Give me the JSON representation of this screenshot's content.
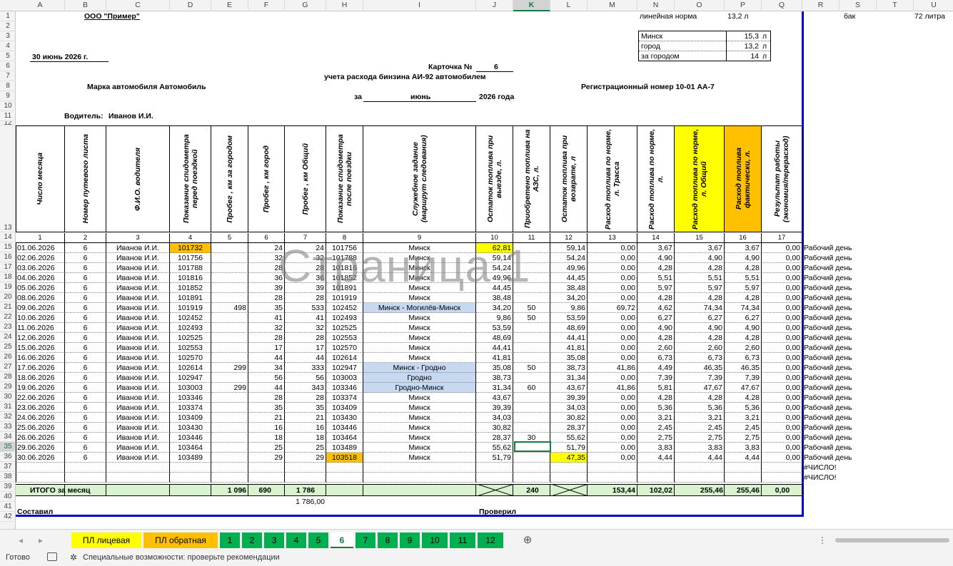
{
  "column_headers": [
    "A",
    "B",
    "C",
    "D",
    "E",
    "F",
    "G",
    "H",
    "I",
    "J",
    "K",
    "L",
    "M",
    "N",
    "O",
    "P",
    "Q",
    "R",
    "S",
    "T",
    "U"
  ],
  "selected_column": "K",
  "selected_row": "35",
  "top": {
    "company": "ООО \"Пример\"",
    "date": "30 июнь 2026 г.",
    "card_label": "Карточка №",
    "card_number": "6",
    "subtitle": "учета расхода бинзина АИ-92 автомобилем",
    "brand": "Марка автомобиля Автомобиль",
    "reg_number": "Регистрационный номер 10-01 АА-7",
    "period_for": "за",
    "period_month": "июнь",
    "period_year": "2026 года",
    "driver_label": "Водитель:",
    "driver_name": "Иванов И.И."
  },
  "norms": {
    "linear_label": "линейная норма",
    "linear_value": "13,2 л",
    "tank_label": "бак",
    "tank_value": "72 литра",
    "minsk_label": "Минск",
    "minsk_value": "15,3",
    "city_label": "город",
    "city_value": "13,2",
    "outside_label": "за городом",
    "outside_value": "14",
    "unit": "л"
  },
  "table_headers": [
    "Число месяца",
    "Номер путевого листа",
    "Ф.И.О. водителя",
    "Показание спидометра перед поездкой",
    "Пробег , км  за городом",
    "Пробег , км город",
    "Пробег , км Общий",
    "Показание спидометра после поездки",
    "Служебное задание (маршрут следования)",
    "Остаток топлива при выезде, л.",
    "Приобретено топлива на АЗС, л.",
    "Остаток топлива при возврате, л",
    "Расход топлива по норме, л. Трасса",
    "Расход топлива по норме, л.",
    "Расход топлива по норме, л. Общий",
    "Расход топлива фактически, л.",
    "Результат работы (экономия/перерасход)"
  ],
  "column_numbers": [
    "1",
    "2",
    "3",
    "4",
    "5",
    "6",
    "7",
    "8",
    "9",
    "10",
    "11",
    "12",
    "13",
    "14",
    "15",
    "16",
    "17"
  ],
  "rows": [
    [
      "01.06.2026",
      "6",
      "Иванов И.И.",
      "101732",
      "",
      "24",
      "24",
      "101756",
      "Минск",
      "62,81",
      "",
      "59,14",
      "0,00",
      "3,67",
      "3,67",
      "3,67",
      "0,00",
      "Рабочий день"
    ],
    [
      "02.06.2026",
      "6",
      "Иванов И.И.",
      "101756",
      "",
      "32",
      "32",
      "101788",
      "Минск",
      "59,14",
      "",
      "54,24",
      "0,00",
      "4,90",
      "4,90",
      "4,90",
      "0,00",
      "Рабочий день"
    ],
    [
      "03.06.2026",
      "6",
      "Иванов И.И.",
      "101788",
      "",
      "28",
      "28",
      "101816",
      "Минск",
      "54,24",
      "",
      "49,96",
      "0,00",
      "4,28",
      "4,28",
      "4,28",
      "0,00",
      "Рабочий день"
    ],
    [
      "04.06.2026",
      "6",
      "Иванов И.И.",
      "101816",
      "",
      "36",
      "36",
      "101852",
      "Минск",
      "49,96",
      "",
      "44,45",
      "0,00",
      "5,51",
      "5,51",
      "5,51",
      "0,00",
      "Рабочий день"
    ],
    [
      "05.06.2026",
      "6",
      "Иванов И.И.",
      "101852",
      "",
      "39",
      "39",
      "101891",
      "Минск",
      "44,45",
      "",
      "38,48",
      "0,00",
      "5,97",
      "5,97",
      "5,97",
      "0,00",
      "Рабочий день"
    ],
    [
      "08.06.2026",
      "6",
      "Иванов И.И.",
      "101891",
      "",
      "28",
      "28",
      "101919",
      "Минск",
      "38,48",
      "",
      "34,20",
      "0,00",
      "4,28",
      "4,28",
      "4,28",
      "0,00",
      "Рабочий день"
    ],
    [
      "09.06.2026",
      "6",
      "Иванов И.И.",
      "101919",
      "498",
      "35",
      "533",
      "102452",
      "Минск - Могилёв-Минск",
      "34,20",
      "50",
      "9,86",
      "69,72",
      "4,62",
      "74,34",
      "74,34",
      "0,00",
      "Рабочий день"
    ],
    [
      "10.06.2026",
      "6",
      "Иванов И.И.",
      "102452",
      "",
      "41",
      "41",
      "102493",
      "Минск",
      "9,86",
      "50",
      "53,59",
      "0,00",
      "6,27",
      "6,27",
      "6,27",
      "0,00",
      "Рабочий день"
    ],
    [
      "11.06.2026",
      "6",
      "Иванов И.И.",
      "102493",
      "",
      "32",
      "32",
      "102525",
      "Минск",
      "53,59",
      "",
      "48,69",
      "0,00",
      "4,90",
      "4,90",
      "4,90",
      "0,00",
      "Рабочий день"
    ],
    [
      "12.06.2026",
      "6",
      "Иванов И.И.",
      "102525",
      "",
      "28",
      "28",
      "102553",
      "Минск",
      "48,69",
      "",
      "44,41",
      "0,00",
      "4,28",
      "4,28",
      "4,28",
      "0,00",
      "Рабочий день"
    ],
    [
      "15.06.2026",
      "6",
      "Иванов И.И.",
      "102553",
      "",
      "17",
      "17",
      "102570",
      "Минск",
      "44,41",
      "",
      "41,81",
      "0,00",
      "2,60",
      "2,60",
      "2,60",
      "0,00",
      "Рабочий день"
    ],
    [
      "16.06.2026",
      "6",
      "Иванов И.И.",
      "102570",
      "",
      "44",
      "44",
      "102614",
      "Минск",
      "41,81",
      "",
      "35,08",
      "0,00",
      "6,73",
      "6,73",
      "6,73",
      "0,00",
      "Рабочий день"
    ],
    [
      "17.06.2026",
      "6",
      "Иванов И.И.",
      "102614",
      "299",
      "34",
      "333",
      "102947",
      "Минск - Гродно",
      "35,08",
      "50",
      "38,73",
      "41,86",
      "4,49",
      "46,35",
      "46,35",
      "0,00",
      "Рабочий день"
    ],
    [
      "18.06.2026",
      "6",
      "Иванов И.И.",
      "102947",
      "",
      "56",
      "56",
      "103003",
      "Гродно",
      "38,73",
      "",
      "31,34",
      "0,00",
      "7,39",
      "7,39",
      "7,39",
      "0,00",
      "Рабочий день"
    ],
    [
      "19.06.2026",
      "6",
      "Иванов И.И.",
      "103003",
      "299",
      "44",
      "343",
      "103346",
      "Гродно-Минск",
      "31,34",
      "60",
      "43,67",
      "41,86",
      "5,81",
      "47,67",
      "47,67",
      "0,00",
      "Рабочий день"
    ],
    [
      "22.06.2026",
      "6",
      "Иванов И.И.",
      "103346",
      "",
      "28",
      "28",
      "103374",
      "Минск",
      "43,67",
      "",
      "39,39",
      "0,00",
      "4,28",
      "4,28",
      "4,28",
      "0,00",
      "Рабочий день"
    ],
    [
      "23.06.2026",
      "6",
      "Иванов И.И.",
      "103374",
      "",
      "35",
      "35",
      "103409",
      "Минск",
      "39,39",
      "",
      "34,03",
      "0,00",
      "5,36",
      "5,36",
      "5,36",
      "0,00",
      "Рабочий день"
    ],
    [
      "24.06.2026",
      "6",
      "Иванов И.И.",
      "103409",
      "",
      "21",
      "21",
      "103430",
      "Минск",
      "34,03",
      "",
      "30,82",
      "0,00",
      "3,21",
      "3,21",
      "3,21",
      "0,00",
      "Рабочий день"
    ],
    [
      "25.06.2026",
      "6",
      "Иванов И.И.",
      "103430",
      "",
      "16",
      "16",
      "103446",
      "Минск",
      "30,82",
      "",
      "28,37",
      "0,00",
      "2,45",
      "2,45",
      "2,45",
      "0,00",
      "Рабочий день"
    ],
    [
      "26.06.2026",
      "6",
      "Иванов И.И.",
      "103446",
      "",
      "18",
      "18",
      "103464",
      "Минск",
      "28,37",
      "30",
      "55,62",
      "0,00",
      "2,75",
      "2,75",
      "2,75",
      "0,00",
      "Рабочий день"
    ],
    [
      "29.06.2026",
      "6",
      "Иванов И.И.",
      "103464",
      "",
      "25",
      "25",
      "103489",
      "Минск",
      "55,62",
      "",
      "51,79",
      "0,00",
      "3,83",
      "3,83",
      "3,83",
      "0,00",
      "Рабочий день"
    ],
    [
      "30.06.2026",
      "6",
      "Иванов И.И.",
      "103489",
      "",
      "29",
      "29",
      "103518",
      "Минск",
      "51,79",
      "",
      "47,35",
      "0,00",
      "4,44",
      "4,44",
      "4,44",
      "0,00",
      "Рабочий день"
    ]
  ],
  "errors": [
    "#ЧИСЛО!",
    "#ЧИСЛО!"
  ],
  "totals": {
    "label": "ИТОГО за месяц",
    "outside_km": "1 096",
    "city_km": "690",
    "total_km": "1 786",
    "purchased": "240",
    "norm_highway": "153,44",
    "norm": "102,02",
    "norm_total": "255,46",
    "actual": "255,46",
    "result": "0,00",
    "total_km_below": "1 786,00"
  },
  "footer": {
    "compiled": "Составил",
    "checked": "Проверил"
  },
  "watermark": "Страница 1",
  "sheet_tabs": [
    {
      "label": "ПЛ лицевая",
      "color": "#ffff00"
    },
    {
      "label": "ПЛ обратная",
      "color": "#ffc000"
    },
    {
      "label": "1",
      "color": "#00b050"
    },
    {
      "label": "2",
      "color": "#00b050"
    },
    {
      "label": "3",
      "color": "#00b050"
    },
    {
      "label": "4",
      "color": "#00b050"
    },
    {
      "label": "5",
      "color": "#00b050"
    },
    {
      "label": "6",
      "color": "#ffffff"
    },
    {
      "label": "7",
      "color": "#00b050"
    },
    {
      "label": "8",
      "color": "#00b050"
    },
    {
      "label": "9",
      "color": "#00b050"
    },
    {
      "label": "10",
      "color": "#00b050"
    },
    {
      "label": "11",
      "color": "#00b050"
    },
    {
      "label": "12",
      "color": "#00b050"
    }
  ],
  "active_tab": "6",
  "status": {
    "ready": "Готово",
    "accessibility": "Специальные возможности: проверьте рекомендации"
  },
  "colors": {
    "yellow": "#ffff00",
    "orange": "#ffc000",
    "light_blue": "#c6d9f1",
    "total_row_green": "#d9f2d0",
    "tab_green": "#00b050",
    "accent_green": "#107c41",
    "frame_blue": "#0000cc"
  }
}
